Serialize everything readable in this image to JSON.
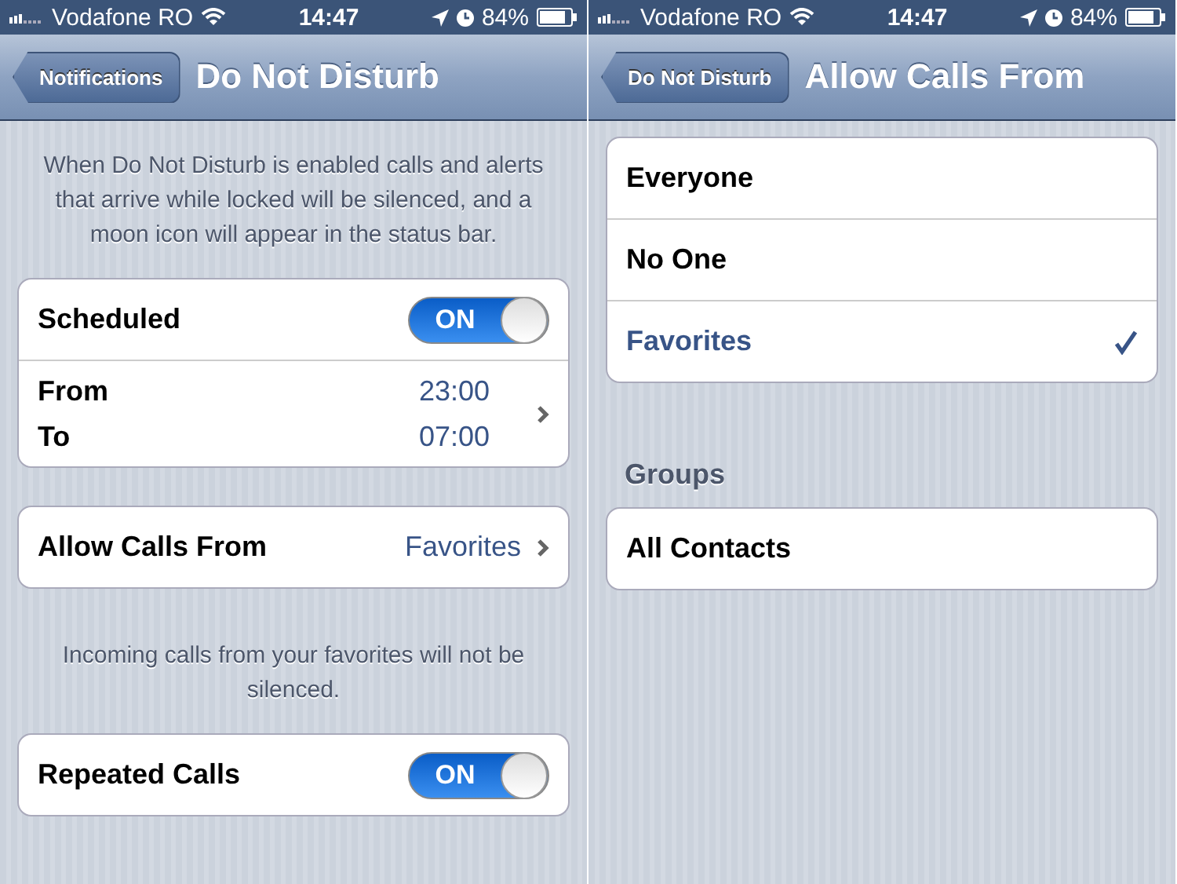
{
  "screens": [
    {
      "status_bar": {
        "carrier": "Vodafone RO",
        "time": "14:47",
        "battery": "84%"
      },
      "nav": {
        "back": "Notifications",
        "title": "Do Not Disturb"
      },
      "sections": [
        {
          "kind": "note",
          "text": "When Do Not Disturb is enabled calls and alerts that arrive while locked will be silenced, and a moon icon will appear in the status bar."
        },
        {
          "kind": "group",
          "rows": [
            {
              "kind": "toggle",
              "label": "Scheduled",
              "on": true,
              "switch_text": "ON"
            },
            {
              "kind": "times",
              "times": [
                {
                  "label": "From",
                  "value": "23:00"
                },
                {
                  "label": "To",
                  "value": "07:00"
                }
              ]
            }
          ]
        },
        {
          "kind": "group",
          "rows": [
            {
              "kind": "link",
              "label": "Allow Calls From",
              "value": "Favorites"
            }
          ]
        },
        {
          "kind": "note",
          "text": "Incoming calls from your favorites will not be silenced."
        },
        {
          "kind": "group",
          "rows": [
            {
              "kind": "toggle",
              "label": "Repeated Calls",
              "on": true,
              "switch_text": "ON"
            }
          ]
        }
      ]
    },
    {
      "status_bar": {
        "carrier": "Vodafone RO",
        "time": "14:47",
        "battery": "84%"
      },
      "nav": {
        "back": "Do Not Disturb",
        "title": "Allow Calls From"
      },
      "sections": [
        {
          "kind": "group",
          "rows": [
            {
              "kind": "option",
              "label": "Everyone",
              "selected": false
            },
            {
              "kind": "option",
              "label": "No One",
              "selected": false
            },
            {
              "kind": "option",
              "label": "Favorites",
              "selected": true
            }
          ]
        },
        {
          "kind": "header",
          "text": "Groups"
        },
        {
          "kind": "group",
          "rows": [
            {
              "kind": "option",
              "label": "All Contacts",
              "selected": false
            }
          ]
        }
      ]
    }
  ]
}
